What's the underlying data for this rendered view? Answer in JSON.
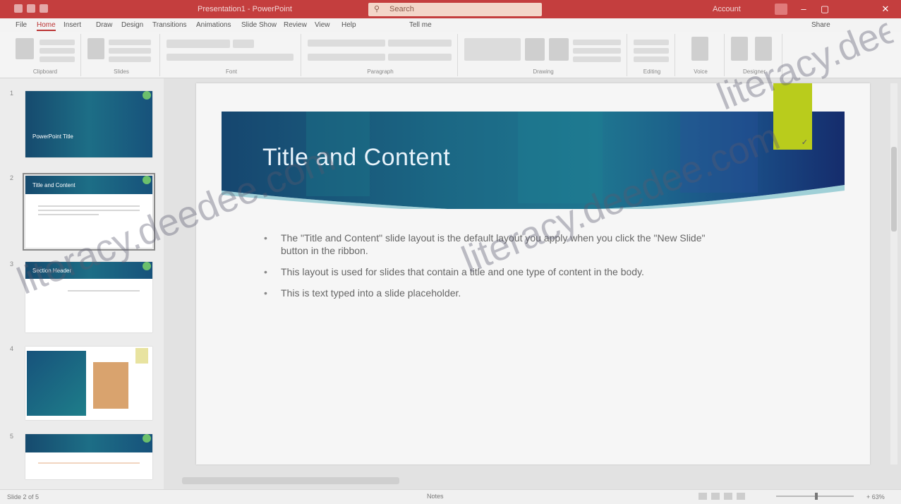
{
  "titlebar": {
    "doc_title": "Presentation1 - PowerPoint",
    "search_label": "Search",
    "user_name": "Account",
    "min": "–",
    "max": "▢",
    "close": "✕"
  },
  "tabs": [
    "File",
    "Home",
    "Insert",
    "Draw",
    "Design",
    "Transitions",
    "Animations",
    "Slide Show",
    "Review",
    "View",
    "Help",
    "Tell me"
  ],
  "active_tab": "Home",
  "share_label": "Share",
  "ribbon": {
    "groups": [
      "Clipboard",
      "Slides",
      "Font",
      "Paragraph",
      "Drawing",
      "Editing",
      "Voice",
      "Designer"
    ]
  },
  "thumbnails": [
    {
      "num": "1",
      "title": "PowerPoint Title"
    },
    {
      "num": "2",
      "title": "Title and Content"
    },
    {
      "num": "3",
      "title": "Section Header"
    },
    {
      "num": "4",
      "title": ""
    },
    {
      "num": "5",
      "title": ""
    }
  ],
  "slide": {
    "title": "Title and Content",
    "tag_mark": "✓",
    "bullets": [
      "The \"Title and Content\" slide layout is the default layout you apply when you click the \"New Slide\" button in the ribbon.",
      "This layout is used for slides that contain a title and one type of content in the body.",
      "This is text typed into a slide placeholder."
    ],
    "bullet_char": "•"
  },
  "status": {
    "slide_number": "Slide 2 of 5",
    "notes": "Notes",
    "zoom": "+ 63%"
  },
  "watermarks": [
    "literacy.deedee.com",
    "literacy.deedee.com",
    "literacy.deedee.com"
  ],
  "colors": {
    "titlebar": "#c43e3e",
    "band_start": "#164a6e",
    "band_end": "#17527b",
    "accent_tag": "#b9cc1c"
  }
}
